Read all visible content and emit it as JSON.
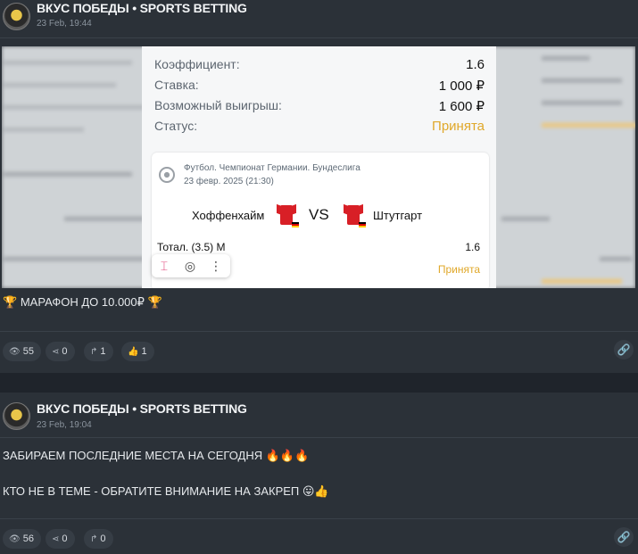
{
  "post1": {
    "channel": "ВКУС ПОБЕДЫ • SPORTS BETTING",
    "date": "23 Feb, 19:44",
    "bet_card": {
      "coef_label": "Коэффициент:",
      "coef_value": "1.6",
      "stake_label": "Ставка:",
      "stake_value": "1 000 ₽",
      "win_label": "Возможный выигрыш:",
      "win_value": "1 600 ₽",
      "status_label": "Статус:",
      "status_value": "Принята",
      "league": "Футбол. Чемпионат Германии. Бундеслига",
      "match_date": "23 февр. 2025 (21:30)",
      "home": "Хоффенхайм",
      "vs": "VS",
      "away": "Штутгарт",
      "bet": "Тотал. (3.5) М",
      "bet_coef": "1.6",
      "bet_status": "Принята"
    },
    "caption": "МАРАФОН ДО 10.000₽",
    "stats": {
      "views": "55",
      "forwards": "0",
      "replies": "1",
      "likes": "1"
    }
  },
  "post2": {
    "channel": "ВКУС ПОБЕДЫ • SPORTS BETTING",
    "date": "23 Feb, 19:04",
    "line1": "ЗАБИРАЕМ ПОСЛЕДНИЕ МЕСТА НА СЕГОДНЯ",
    "line2": "КТО НЕ В ТЕМЕ - ОБРАТИТЕ ВНИМАНИЕ НА ЗАКРЕП",
    "stats": {
      "views": "56",
      "forwards": "0",
      "replies": "0"
    }
  },
  "icons": [
    "avatar",
    "eye-icon",
    "share-icon",
    "reply-icon",
    "thumbs-up-icon",
    "link-icon",
    "trophy-icon",
    "fire-icon",
    "football-icon",
    "shirt-icon",
    "ocr-icon",
    "lens-icon",
    "more-icon"
  ],
  "colors": {
    "background": "#2b3138",
    "accent_status": "#e0a82a"
  }
}
